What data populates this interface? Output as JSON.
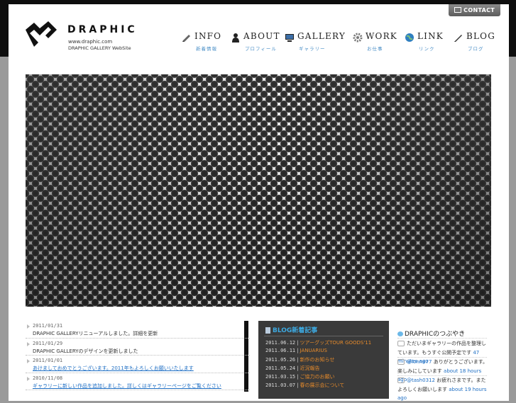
{
  "header": {
    "contact_label": "CONTACT",
    "logo_name": "DRAPHIC",
    "logo_url": "www.draphic.com",
    "logo_tagline": "DRAPHIC GALLERY WebSite"
  },
  "nav": [
    {
      "label": "INFO",
      "sub": "新着情報",
      "icon": "pen-icon"
    },
    {
      "label": "ABOUT",
      "sub": "プロフィール",
      "icon": "person-icon"
    },
    {
      "label": "GALLERY",
      "sub": "ギャラリー",
      "icon": "monitor-icon"
    },
    {
      "label": "WORK",
      "sub": "お仕事",
      "icon": "gear-icon"
    },
    {
      "label": "LINK",
      "sub": "リンク",
      "icon": "globe-icon"
    },
    {
      "label": "BLOG",
      "sub": "ブログ",
      "icon": "pencil-icon"
    }
  ],
  "news": [
    {
      "date": "2011/01/31",
      "title": "DRAPHIC GALLERYリニューアルしました。詳細を更新",
      "link": false
    },
    {
      "date": "2011/01/29",
      "title": "DRAPHIC GALLERYのデザインを更新しました",
      "link": false
    },
    {
      "date": "2011/01/01",
      "title": "あけましておめでとうございます。2011年もよろしくお願いいたします",
      "link": true
    },
    {
      "date": "2010/11/08",
      "title": "ギャラリーに新しい作品を追加しました。詳しくはギャラリーページをご覧ください",
      "link": true
    }
  ],
  "blog": {
    "heading": "BLOG新着記事",
    "entries": [
      {
        "date": "2011.06.12",
        "title": "ツアーグッズTOUR GOODS'11"
      },
      {
        "date": "2011.06.11",
        "title": "JANUARIUS"
      },
      {
        "date": "2011.05.26",
        "title": "新作のお知らせ"
      },
      {
        "date": "2011.05.24",
        "title": "近況報告"
      },
      {
        "date": "2011.03.15",
        "title": "ご協力のお願い"
      },
      {
        "date": "2011.03.07",
        "title": "春の展示会について"
      }
    ]
  },
  "twitter": {
    "heading": "DRAPHICのつぶやき",
    "tweets": [
      {
        "user": "",
        "text": "ただいまギャラリーの作品を整理しています。もうすぐ公開予定です",
        "ago": "47 minutes ago"
      },
      {
        "user": "@lonn877",
        "text": "ありがとうございます。楽しみにしています",
        "ago": "about 18 hours ago"
      },
      {
        "user": "@tash0312",
        "text": "お疲れさまです。またよろしくお願いします",
        "ago": "about 19 hours ago"
      }
    ]
  },
  "colors": {
    "accent_blue": "#1f6fc4",
    "blog_orange": "#e58a2b",
    "topbar": "#0e0e0e"
  }
}
